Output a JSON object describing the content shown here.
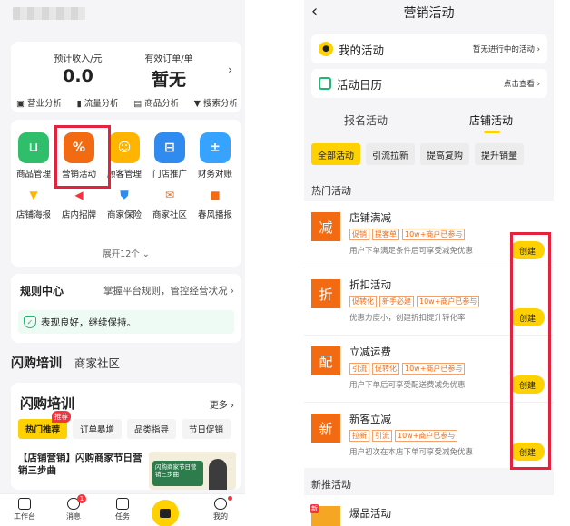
{
  "left": {
    "income": {
      "expected_label": "预计收入/元",
      "expected_value": "0.0",
      "orders_label": "有效订单/单",
      "orders_value": "暂无",
      "analysis": [
        "营业分析",
        "流量分析",
        "商品分析",
        "搜索分析"
      ]
    },
    "tools_row1": [
      {
        "label": "商品管理",
        "icon": "bag-icon",
        "color": "#2fbf6b"
      },
      {
        "label": "营销活动",
        "icon": "percent-icon",
        "color": "#f26b12"
      },
      {
        "label": "顾客管理",
        "icon": "smile-icon",
        "color": "#ffb400"
      },
      {
        "label": "门店推广",
        "icon": "basket-icon",
        "color": "#2f8bf0"
      },
      {
        "label": "财务对账",
        "icon": "calculator-icon",
        "color": "#35a3ff"
      }
    ],
    "tools_row2": [
      {
        "label": "店铺海报",
        "icon": "brush-icon",
        "color": "#ffb400"
      },
      {
        "label": "店内招牌",
        "icon": "megaphone-icon",
        "color": "#f5333f"
      },
      {
        "label": "商家保险",
        "icon": "shield-check-icon",
        "color": "#2f8bf0"
      },
      {
        "label": "商家社区",
        "icon": "mail-icon",
        "color": "#f26b12"
      },
      {
        "label": "春风播报",
        "icon": "spring-icon",
        "color": "#f26b12"
      }
    ],
    "expand_label": "展开12个",
    "rules": {
      "title": "规则中心",
      "subtitle": "掌握平台规则，管控经营状况",
      "status": "表现良好，继续保持。"
    },
    "page_tabs": [
      "闪购培训",
      "商家社区"
    ],
    "training": {
      "title": "闪购培训",
      "more": "更多",
      "chips": [
        "热门推荐",
        "订单暴增",
        "品类指导",
        "节日促销"
      ],
      "hot_tag": "推荐",
      "article": "【店铺营销】闪购商家节日营销三步曲",
      "thumb_text": "闪购商家节日营销三步曲"
    },
    "tabbar": [
      {
        "label": "工作台",
        "icon": "workbench-icon"
      },
      {
        "label": "消息",
        "icon": "message-icon",
        "badge": "1"
      },
      {
        "label": "任务",
        "icon": "task-icon"
      },
      {
        "label": "",
        "icon": "center-icon"
      },
      {
        "label": "我的",
        "icon": "user-icon"
      }
    ]
  },
  "right": {
    "title": "营销活动",
    "my_activity": {
      "label": "我的活动",
      "hint": "暂无进行中的活动"
    },
    "calendar": {
      "label": "活动日历",
      "hint": "点击查看"
    },
    "tabs": [
      "报名活动",
      "店铺活动"
    ],
    "filters": [
      "全部活动",
      "引流拉新",
      "提高复购",
      "提升销量"
    ],
    "hot_title": "热门活动",
    "activities": [
      {
        "icon_char": "减",
        "name": "店铺满减",
        "tags": [
          "促销",
          "提客单",
          "10w+商户已参与"
        ],
        "desc": "用户下单满足条件后可享受减免优惠",
        "btn": "创建"
      },
      {
        "icon_char": "折",
        "name": "折扣活动",
        "tags": [
          "促转化",
          "新手必建",
          "10w+商户已参与"
        ],
        "desc": "优惠力度小，创建折扣提升转化率",
        "btn": "创建"
      },
      {
        "icon_char": "配",
        "name": "立减运费",
        "tags": [
          "引流",
          "促转化",
          "10w+商户已参与"
        ],
        "desc": "用户下单后可享受配送费减免优惠",
        "btn": "创建"
      },
      {
        "icon_char": "新",
        "name": "新客立减",
        "tags": [
          "拉新",
          "引流",
          "10w+商户已参与"
        ],
        "desc": "用户初次在本店下单可享受减免优惠",
        "btn": "创建"
      }
    ],
    "new_title": "新推活动",
    "new_item": {
      "badge": "新",
      "name": "爆品活动"
    }
  }
}
